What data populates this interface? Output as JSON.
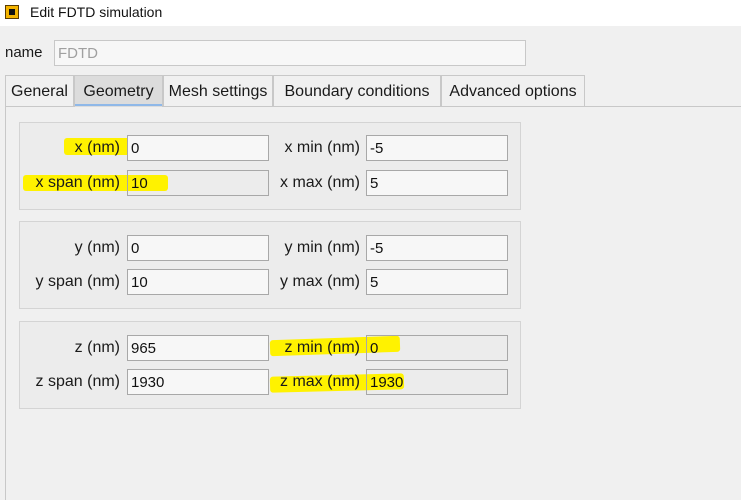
{
  "window": {
    "title": "Edit FDTD simulation"
  },
  "name_field": {
    "label": "name",
    "value": "FDTD"
  },
  "tabs": [
    {
      "label": "General",
      "active": false
    },
    {
      "label": "Geometry",
      "active": true
    },
    {
      "label": "Mesh settings",
      "active": false
    },
    {
      "label": "Boundary conditions",
      "active": false
    },
    {
      "label": "Advanced options",
      "active": false
    }
  ],
  "groups": {
    "x": {
      "center_label": "x (nm)",
      "center_value": "0",
      "span_label": "x span (nm)",
      "span_value": "10",
      "min_label": "x min (nm)",
      "min_value": "-5",
      "max_label": "x max (nm)",
      "max_value": "5"
    },
    "y": {
      "center_label": "y (nm)",
      "center_value": "0",
      "span_label": "y span (nm)",
      "span_value": "10",
      "min_label": "y min (nm)",
      "min_value": "-5",
      "max_label": "y max (nm)",
      "max_value": "5"
    },
    "z": {
      "center_label": "z (nm)",
      "center_value": "965",
      "span_label": "z span (nm)",
      "span_value": "1930",
      "min_label": "z min (nm)",
      "min_value": "0",
      "max_label": "z max (nm)",
      "max_value": "1930"
    }
  },
  "colors": {
    "highlight": "#fff200",
    "tab_highlight": "#7ec832"
  },
  "icons": {
    "app": "lumerical-app-icon"
  }
}
